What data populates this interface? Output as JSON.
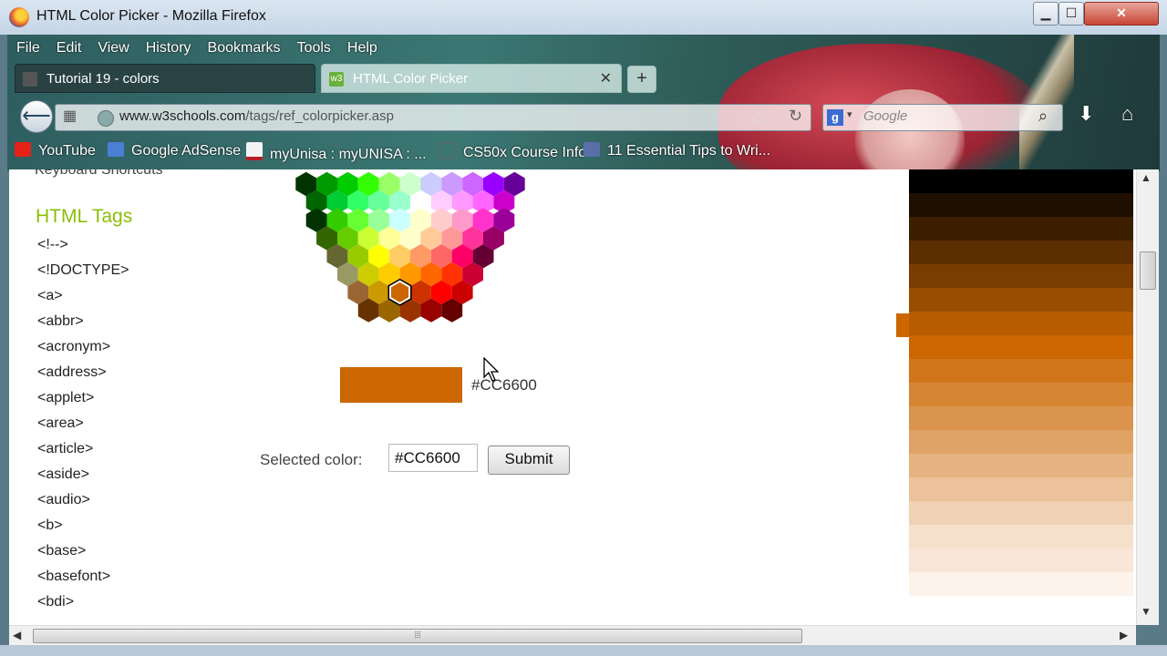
{
  "window": {
    "title": "HTML Color Picker - Mozilla Firefox",
    "controls": {
      "minimize": "▁",
      "maximize": "☐",
      "close": "✕"
    }
  },
  "menubar": [
    "File",
    "Edit",
    "View",
    "History",
    "Bookmarks",
    "Tools",
    "Help"
  ],
  "tabs": [
    {
      "label": "Tutorial 19 - colors",
      "active": false
    },
    {
      "label": "HTML Color Picker",
      "active": true,
      "favicon": "w3"
    }
  ],
  "navbar": {
    "url_host": "www.w3schools.com",
    "url_path": "/tags/ref_colorpicker.asp",
    "search_placeholder": "Google",
    "search_engine": "g"
  },
  "bookmarks": [
    {
      "label": "YouTube",
      "icon": "youtube-icon",
      "color": "#e62117"
    },
    {
      "label": "Google AdSense",
      "icon": "adsense-icon",
      "color": "#4a7fd4"
    },
    {
      "label": "myUnisa : myUNISA : ...",
      "icon": "unisa-icon",
      "color": "#b32025"
    },
    {
      "label": "CS50x Course Info",
      "icon": "cs50-icon",
      "color": "#333333"
    },
    {
      "label": "11 Essential Tips to Wri...",
      "icon": "article-icon",
      "color": "#5a6fa8"
    }
  ],
  "sidebar": {
    "prev_item": "Keyboard Shortcuts",
    "title": "HTML Tags",
    "links": [
      "<!-->",
      "<!DOCTYPE>",
      "<a>",
      "<abbr>",
      "<acronym>",
      "<address>",
      "<applet>",
      "<area>",
      "<article>",
      "<aside>",
      "<audio>",
      "<b>",
      "<base>",
      "<basefont>",
      "<bdi>"
    ]
  },
  "picker": {
    "hex_colors_by_row": [
      [
        "#003300",
        "#009900",
        "#00cc00",
        "#33ff00",
        "#99ff66",
        "#ccffcc",
        "#ccccff",
        "#cc99ff",
        "#cc66ff",
        "#9900ff",
        "#660099"
      ],
      [
        "#006600",
        "#00cc33",
        "#33ff66",
        "#66ff99",
        "#99ffcc",
        "#ffffff",
        "#ffccff",
        "#ff99ff",
        "#ff66ff",
        "#cc00cc"
      ],
      [
        "#003300",
        "#33cc00",
        "#66ff33",
        "#99ff99",
        "#ccffff",
        "#ffffcc",
        "#ffcccc",
        "#ff99cc",
        "#ff33cc",
        "#990099"
      ],
      [
        "#336600",
        "#66cc00",
        "#ccff33",
        "#ffff99",
        "#ffffcc",
        "#ffcc99",
        "#ff9999",
        "#ff3399",
        "#990066"
      ],
      [
        "#666633",
        "#99cc00",
        "#ffff00",
        "#ffcc66",
        "#ff9966",
        "#ff6666",
        "#ff0066",
        "#660033"
      ],
      [
        "#999966",
        "#cccc00",
        "#ffcc00",
        "#ff9900",
        "#ff6600",
        "#ff3300",
        "#cc0033"
      ],
      [
        "#996633",
        "#cc9900",
        "#cc6600",
        "#cc3300",
        "#ff0000",
        "#cc0000"
      ],
      [
        "#663300",
        "#996600",
        "#993300",
        "#990000",
        "#660000"
      ]
    ]
  },
  "selection": {
    "preview_color": "#CC6600",
    "preview_hex": "#CC6600",
    "label": "Selected color:",
    "input_value": "#CC6600",
    "submit_label": "Submit"
  },
  "shades": [
    "#000000",
    "#1f0f00",
    "#3d1f00",
    "#5c2e00",
    "#7a3d00",
    "#994d00",
    "#b85c00",
    "#cc6600",
    "#d1751a",
    "#d68533",
    "#db944d",
    "#e0a366",
    "#e6b380",
    "#ebc299",
    "#f0d1b3",
    "#f5e0cc",
    "#fae6d6",
    "#fdf3eb"
  ],
  "selected_shade": "#CC6600"
}
